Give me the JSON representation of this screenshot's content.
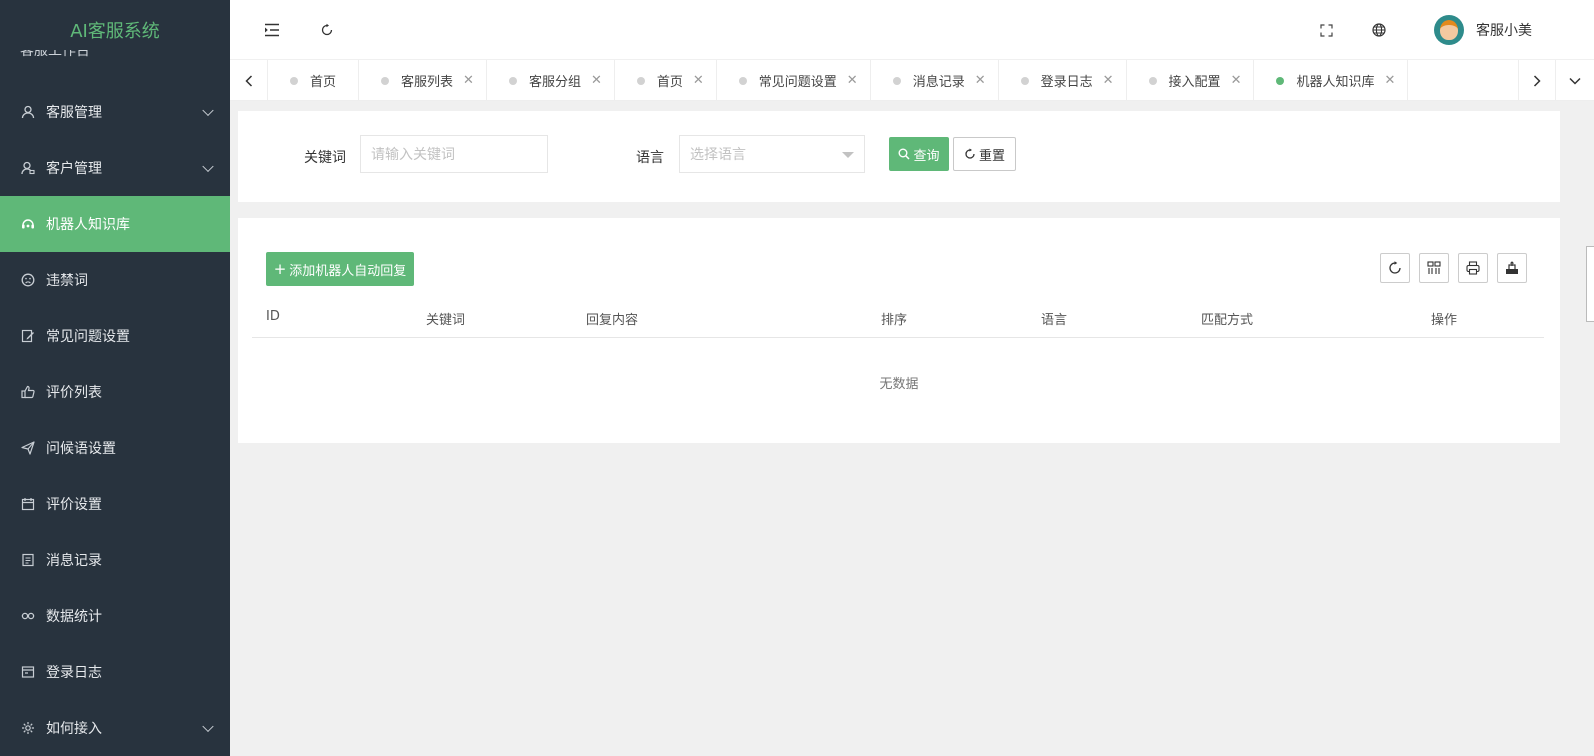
{
  "app": {
    "title": "AI客服系统"
  },
  "sidebar": {
    "peek_label": "客服工作台",
    "items": [
      {
        "label": "客服管理",
        "icon": "user-icon",
        "has_arrow": true
      },
      {
        "label": "客户管理",
        "icon": "customer-icon",
        "has_arrow": true
      },
      {
        "label": "机器人知识库",
        "icon": "robot-icon",
        "active": true
      },
      {
        "label": "违禁词",
        "icon": "face-icon"
      },
      {
        "label": "常见问题设置",
        "icon": "edit-icon"
      },
      {
        "label": "评价列表",
        "icon": "thumb-icon"
      },
      {
        "label": "问候语设置",
        "icon": "send-icon"
      },
      {
        "label": "评价设置",
        "icon": "calendar-icon"
      },
      {
        "label": "消息记录",
        "icon": "note-icon"
      },
      {
        "label": "数据统计",
        "icon": "chain-icon"
      },
      {
        "label": "登录日志",
        "icon": "log-icon"
      },
      {
        "label": "如何接入",
        "icon": "gear-icon",
        "has_arrow": true
      }
    ]
  },
  "header": {
    "user_name": "客服小美"
  },
  "tabs": [
    {
      "label": "首页"
    },
    {
      "label": "客服列表"
    },
    {
      "label": "客服分组"
    },
    {
      "label": "首页"
    },
    {
      "label": "常见问题设置"
    },
    {
      "label": "消息记录"
    },
    {
      "label": "登录日志"
    },
    {
      "label": "接入配置"
    },
    {
      "label": "机器人知识库",
      "active": true
    }
  ],
  "search": {
    "keyword_label": "关键词",
    "keyword_placeholder": "请输入关键词",
    "language_label": "语言",
    "language_placeholder": "选择语言",
    "query_button": "查询",
    "reset_button": "重置"
  },
  "table": {
    "add_button": "添加机器人自动回复",
    "columns": [
      "ID",
      "关键词",
      "回复内容",
      "排序",
      "语言",
      "匹配方式",
      "操作"
    ],
    "empty_text": "无数据"
  },
  "colors": {
    "accent": "#5fb878",
    "sidebar_bg": "#28333e"
  }
}
